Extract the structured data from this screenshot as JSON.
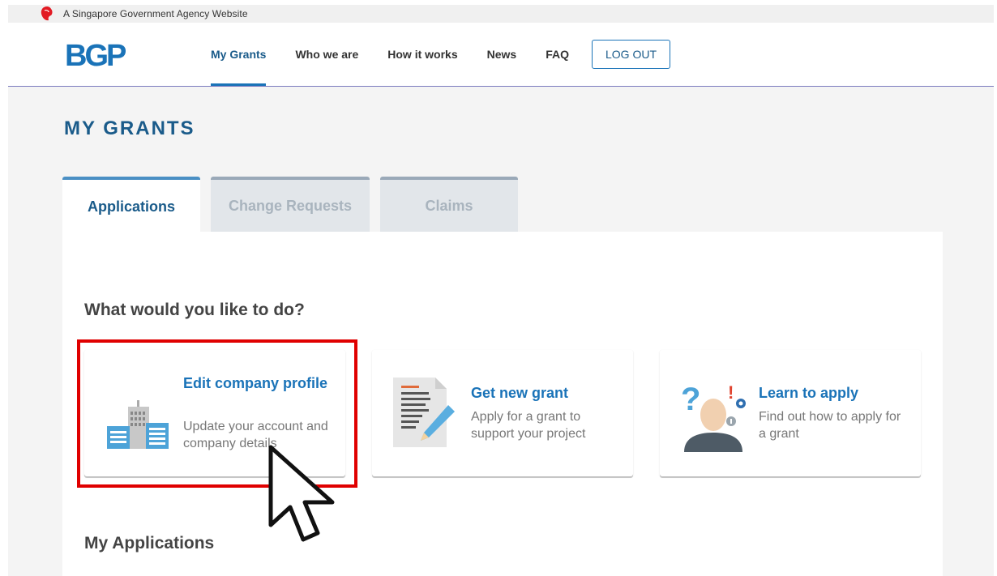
{
  "masthead": {
    "text": "A Singapore Government Agency Website"
  },
  "header": {
    "logo": "BGP",
    "nav": [
      "My Grants",
      "Who we are",
      "How it works",
      "News",
      "FAQ"
    ],
    "logout": "LOG OUT"
  },
  "page": {
    "title": "MY GRANTS",
    "tabs": [
      "Applications",
      "Change Requests",
      "Claims"
    ],
    "active_tab": "Applications",
    "question": "What would you like to do?",
    "cards": [
      {
        "title": "Edit company profile",
        "desc": "Update your account and company details",
        "icon": "building-icon"
      },
      {
        "title": "Get new grant",
        "desc": "Apply for a grant to support your project",
        "icon": "document-pencil-icon"
      },
      {
        "title": "Learn to apply",
        "desc": "Find out how to apply for a grant",
        "icon": "question-person-icon"
      }
    ],
    "my_applications": "My Applications"
  },
  "colors": {
    "accent": "#1a73b8",
    "highlight": "#e00000"
  }
}
